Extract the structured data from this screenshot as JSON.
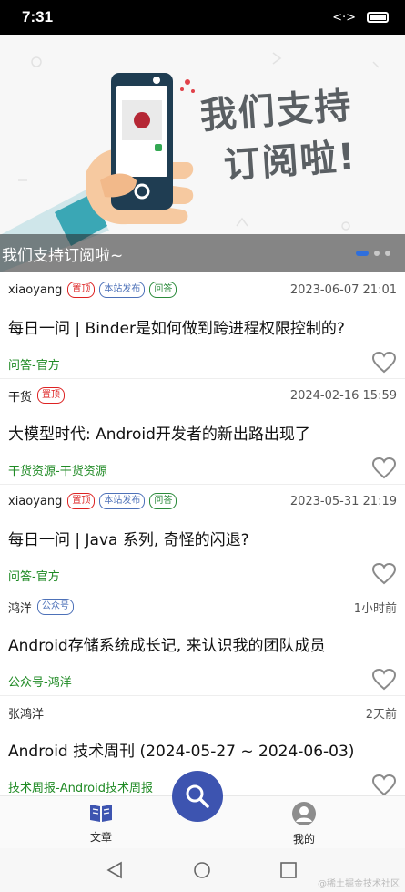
{
  "status_bar": {
    "time": "7:31",
    "icons": [
      "data-arrows-icon",
      "battery-icon"
    ]
  },
  "banner": {
    "headline_line1": "我们支持",
    "headline_line2": "订阅啦!",
    "caption": "我们支持订阅啦~",
    "slide_count": 3,
    "active_slide": 1
  },
  "articles": [
    {
      "author": "xiaoyang",
      "tags": [
        {
          "label": "置顶",
          "color": "red"
        },
        {
          "label": "本站发布",
          "color": "blue"
        },
        {
          "label": "问答",
          "color": "green"
        }
      ],
      "date": "2023-06-07 21:01",
      "title": "每日一问 | Binder是如何做到跨进程权限控制的?",
      "category": "问答-官方"
    },
    {
      "author": "干货",
      "tags": [
        {
          "label": "置顶",
          "color": "red"
        }
      ],
      "date": "2024-02-16 15:59",
      "title": "大模型时代: Android开发者的新出路出现了",
      "category": "干货资源-干货资源"
    },
    {
      "author": "xiaoyang",
      "tags": [
        {
          "label": "置顶",
          "color": "red"
        },
        {
          "label": "本站发布",
          "color": "blue"
        },
        {
          "label": "问答",
          "color": "green"
        }
      ],
      "date": "2023-05-31 21:19",
      "title": "每日一问 | Java 系列, 奇怪的闪退?",
      "category": "问答-官方"
    },
    {
      "author": "鸿洋",
      "tags": [
        {
          "label": "公众号",
          "color": "blue"
        }
      ],
      "date": "1小时前",
      "title": "Android存储系统成长记, 来认识我的团队成员",
      "category": "公众号-鸿洋"
    },
    {
      "author": "张鸿洋",
      "tags": [],
      "date": "2天前",
      "title": "Android 技术周刊 (2024-05-27 ~ 2024-06-03)",
      "category": "技术周报-Android技术周报"
    }
  ],
  "bottom_nav": {
    "articles_label": "文章",
    "mine_label": "我的"
  },
  "watermark": "@稀土掘金技术社区"
}
